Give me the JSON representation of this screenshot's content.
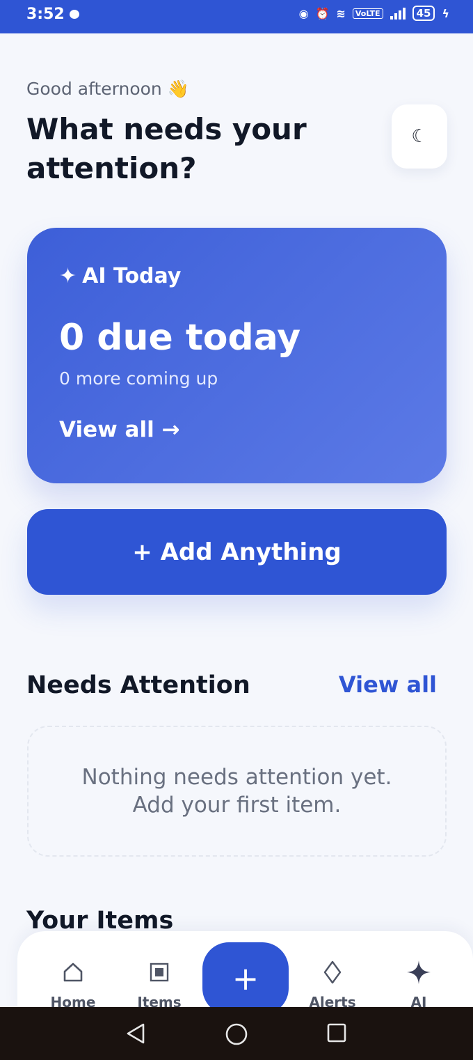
{
  "status_bar": {
    "time": "3:52",
    "volte": "VoLTE",
    "battery": "45"
  },
  "header": {
    "greeting": "Good afternoon 👋",
    "title": "What needs your attention?",
    "theme_icon": "moon-icon"
  },
  "ai_card": {
    "label": "AI Today",
    "due_text": "0 due today",
    "sub_text": "0 more coming up",
    "view_all": "View all →"
  },
  "add_button": {
    "label": "+ Add Anything"
  },
  "needs_attention": {
    "title": "Needs Attention",
    "view_all": "View all",
    "empty_line1": "Nothing needs attention yet.",
    "empty_line2": "Add your first item."
  },
  "your_items": {
    "title": "Your Items"
  },
  "bottom_nav": {
    "items": [
      {
        "label": "Home",
        "icon": "home-icon"
      },
      {
        "label": "Items",
        "icon": "items-icon"
      },
      {
        "label": "Alerts",
        "icon": "alerts-icon"
      },
      {
        "label": "AI",
        "icon": "sparkle-icon"
      }
    ],
    "fab": "+"
  },
  "colors": {
    "primary": "#2f55d4",
    "background": "#f5f7fc",
    "text": "#111827"
  }
}
